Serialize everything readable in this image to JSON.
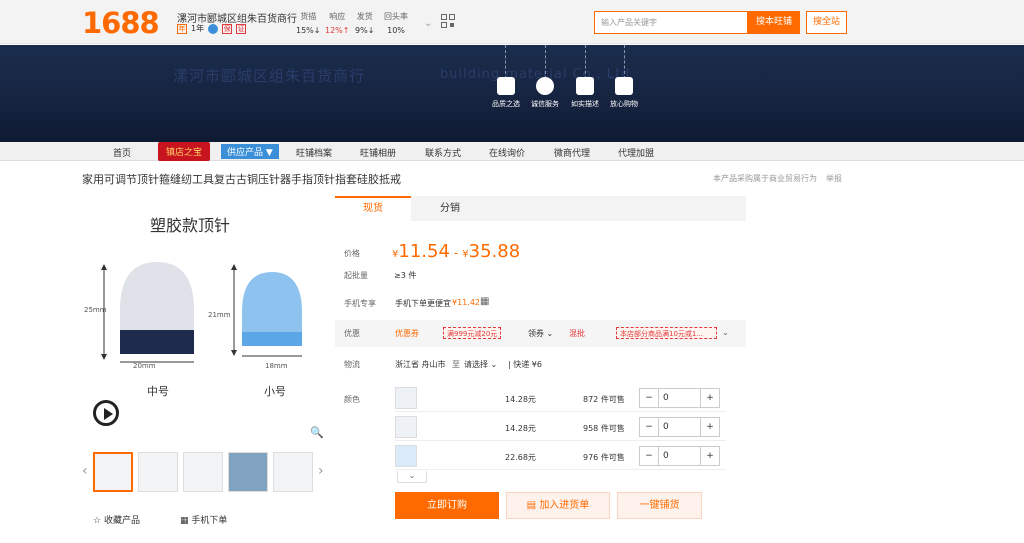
{
  "header": {
    "logo": "1688",
    "shop_name": "漯河市郾城区组朱百货商行",
    "year": "1年",
    "stats": [
      {
        "label": "货描",
        "value": "15%↓"
      },
      {
        "label": "响应",
        "value": "12%↑"
      },
      {
        "label": "发货",
        "value": "9%↓"
      },
      {
        "label": "回头率",
        "value": "10%"
      }
    ],
    "search_placeholder": "输入产品关键字",
    "search_shop": "搜本旺铺",
    "search_all": "搜全站"
  },
  "banner": {
    "name_cn": "漯河市郾城区组朱百货商行",
    "name_en": "building material Co., Ltd",
    "items": [
      "品质之选",
      "诚信服务",
      "如实描述",
      "放心购物"
    ]
  },
  "nav": {
    "items": [
      "首页",
      "旺铺档案",
      "旺铺相册",
      "联系方式",
      "在线询价",
      "微商代理",
      "代理加盟"
    ],
    "badge": "镇店之宝",
    "supply": "供应产品 ▼"
  },
  "product": {
    "title": "家用可调节顶针箍缝纫工具复古古铜压针器手指顶针指套硅胶抵戒",
    "report_note": "本产品采购属于商业贸易行为",
    "report": "举报",
    "image_title": "塑胶款顶针",
    "size_labels": [
      "25mm",
      "20mm",
      "中号",
      "21mm",
      "18mm",
      "小号"
    ],
    "fav": "收藏产品",
    "mobile_order": "手机下单"
  },
  "panel": {
    "tabs": [
      "现货",
      "分销"
    ],
    "price_label": "价格",
    "price_low": "11.54",
    "price_high": "35.88",
    "currency": "¥",
    "moq_label": "起批量",
    "moq": "≥3 件",
    "mobile_label": "手机专享",
    "mobile_text": "手机下单更便宜",
    "mobile_price": "¥11.42",
    "promo_label": "优惠",
    "coupon_label": "优惠券",
    "coupon": "满999元减20元",
    "claim": "领券",
    "mix_label": "混批",
    "mix": "本店部分商品满10元或1...",
    "logistics_label": "物流",
    "origin": "浙江省 舟山市",
    "to": "至",
    "dest": "请选择",
    "express": "快递 ¥6",
    "color_label": "颜色",
    "variants": [
      {
        "price": "14.28元",
        "stock": "872 件可售",
        "qty": "0"
      },
      {
        "price": "14.28元",
        "stock": "958 件可售",
        "qty": "0"
      },
      {
        "price": "22.68元",
        "stock": "976 件可售",
        "qty": "0"
      }
    ],
    "order_btn": "立即订购",
    "cart_btn": "加入进货单",
    "shelf_btn": "一键铺货"
  }
}
